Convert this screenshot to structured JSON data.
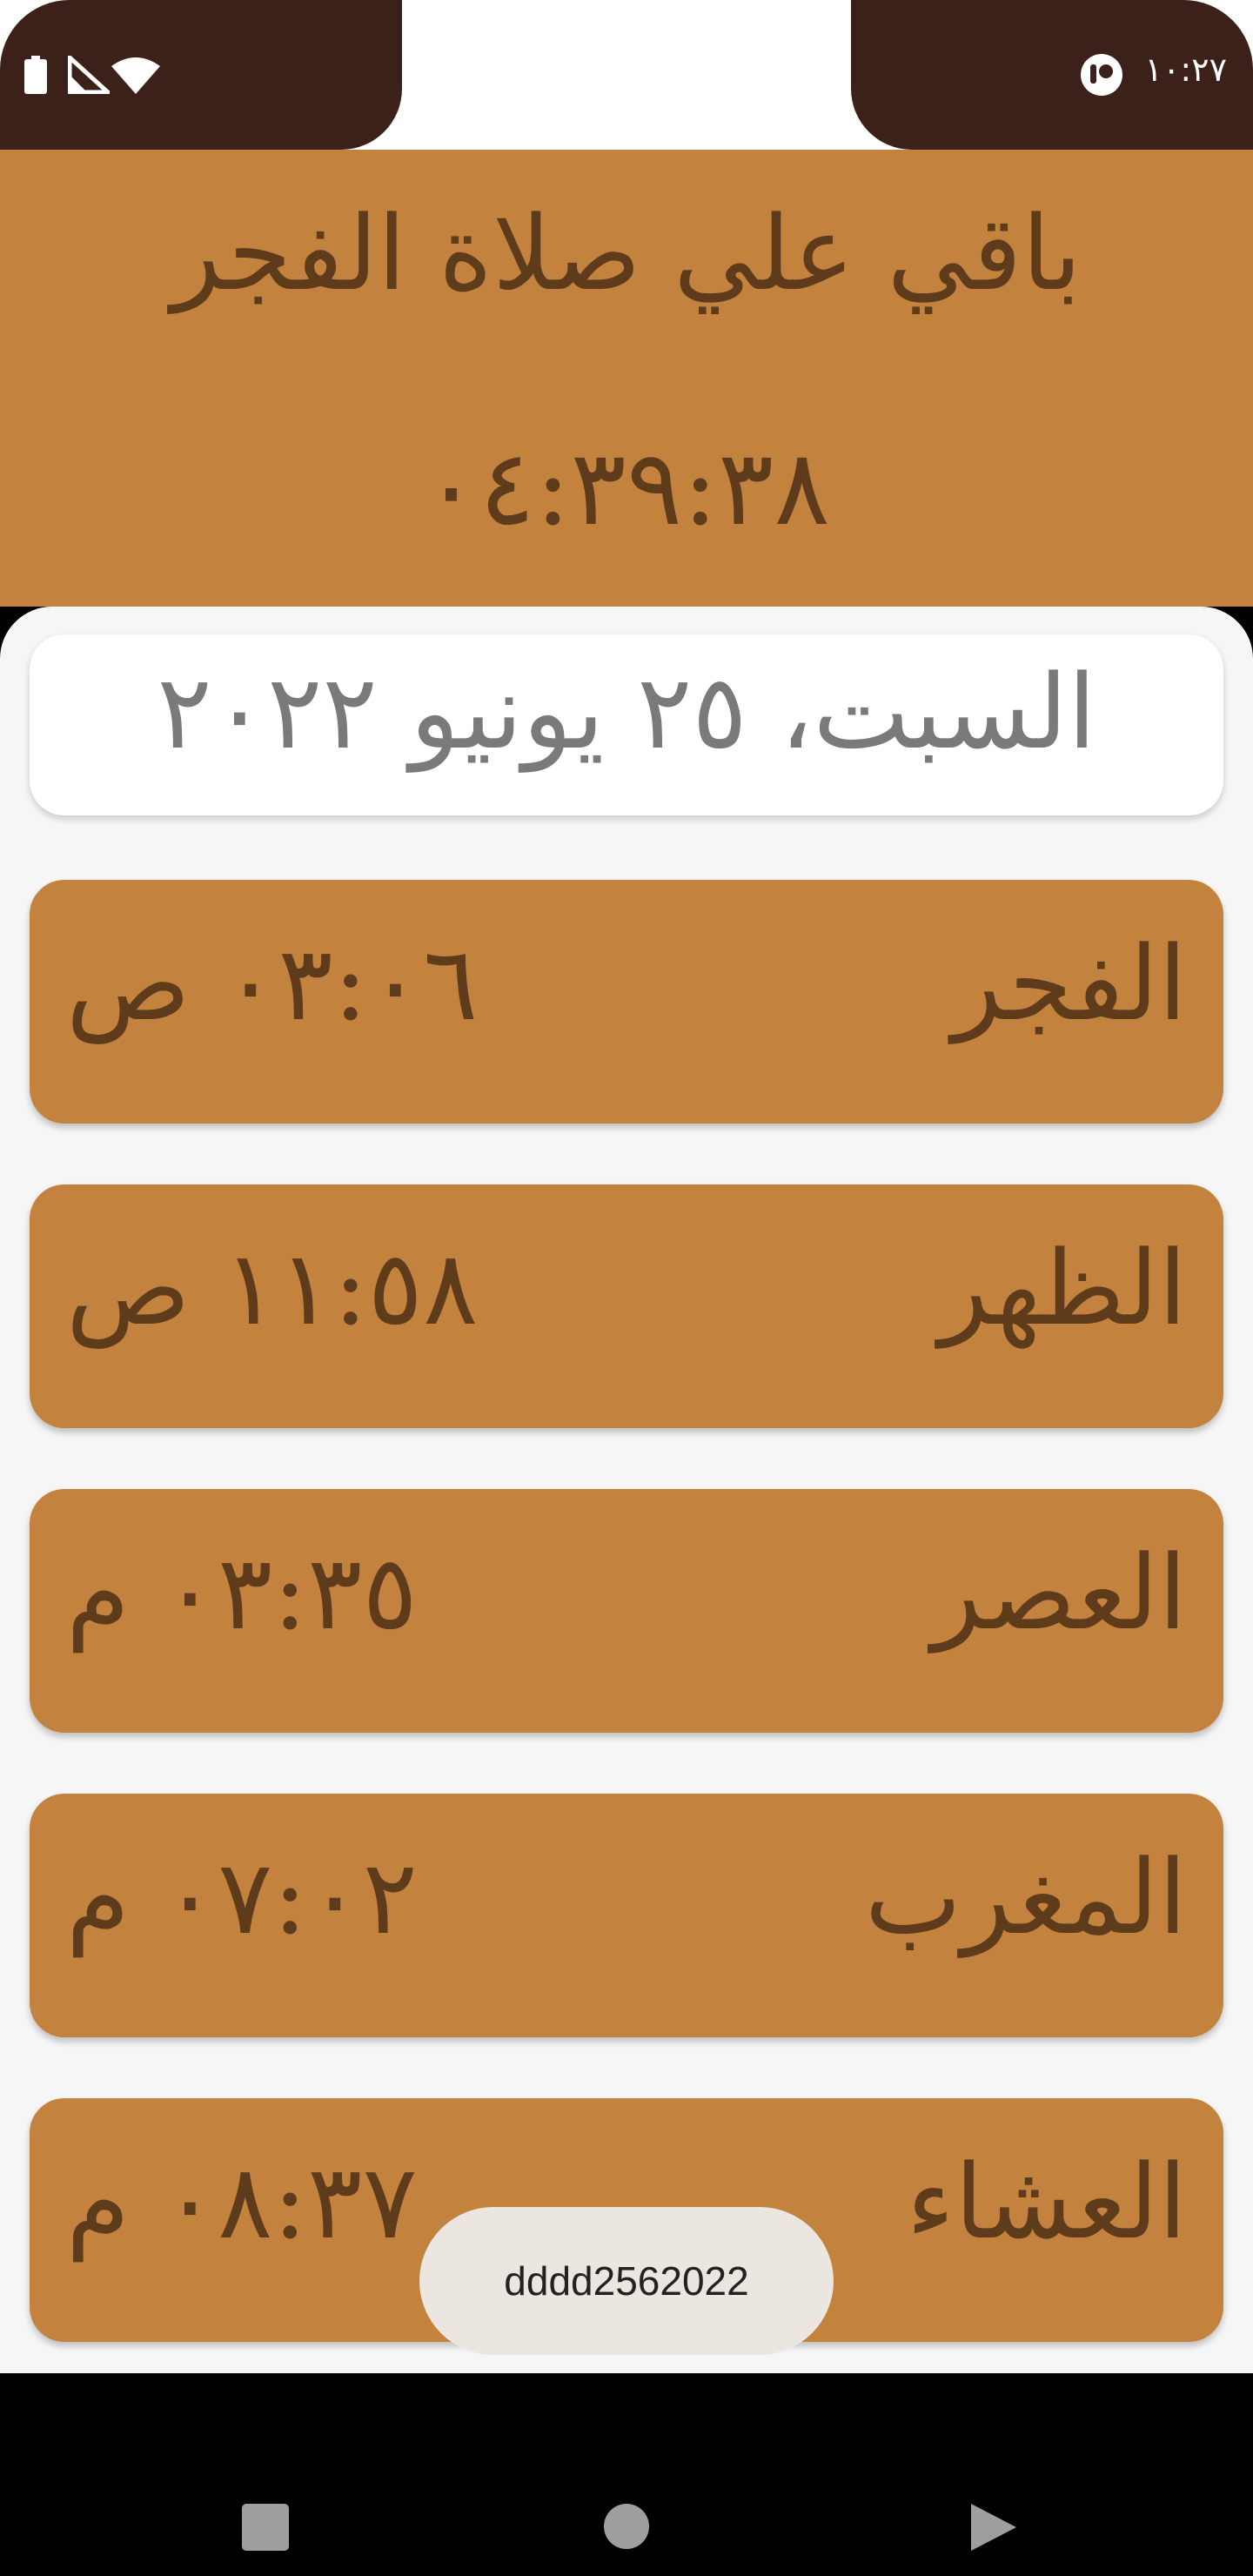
{
  "status_bar": {
    "time": "١٠:٢٧",
    "icons": [
      "battery-icon",
      "signal-icon",
      "wifi-icon",
      "record-icon"
    ]
  },
  "header": {
    "title": "باقي علي صلاة الفجر",
    "countdown": "٠٤:٣٩:٣٨"
  },
  "date": {
    "text": "السبت، ٢٥ يونيو ٢٠٢٢"
  },
  "prayers": [
    {
      "name": "الفجر",
      "time": "٠٣:٠٦ ص"
    },
    {
      "name": "الظهر",
      "time": "١١:٥٨ ص"
    },
    {
      "name": "العصر",
      "time": "٠٣:٣٥ م"
    },
    {
      "name": "المغرب",
      "time": "٠٧:٠٢ م"
    },
    {
      "name": "العشاء",
      "time": "٠٨:٣٧ م"
    }
  ],
  "toast": {
    "text": "dddd2562022"
  },
  "navigation": {
    "icons": [
      "recents-icon",
      "home-icon",
      "back-icon"
    ]
  },
  "colors": {
    "status_bar": "#3c201a",
    "card": "#c4823f",
    "card_text": "#5e3c1b",
    "background": "#f6f6f6"
  }
}
